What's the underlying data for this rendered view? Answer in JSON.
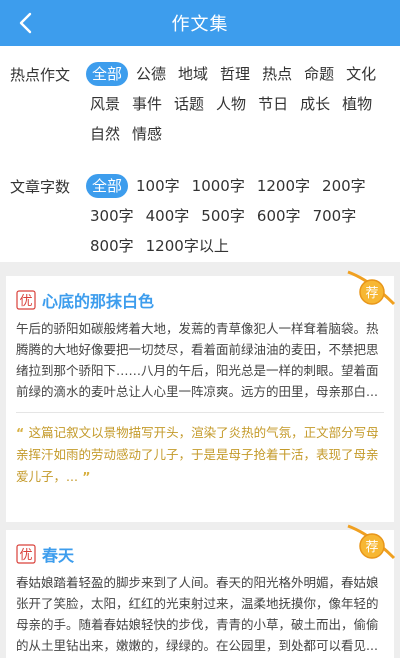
{
  "header": {
    "title": "作文集"
  },
  "filters": {
    "hot": {
      "label": "热点作文",
      "options": [
        "全部",
        "公德",
        "地域",
        "哲理",
        "热点",
        "命题",
        "文化",
        "风景",
        "事件",
        "话题",
        "人物",
        "节日",
        "成长",
        "植物",
        "自然",
        "情感"
      ]
    },
    "words": {
      "label": "文章字数",
      "options": [
        "全部",
        "100字",
        "1000字",
        "1200字",
        "200字",
        "300字",
        "400字",
        "500字",
        "600字",
        "700字",
        "800字",
        "1200字以上"
      ]
    }
  },
  "articles": [
    {
      "badge": "优",
      "title": "心底的那抹白色",
      "rec": "荐",
      "excerpt": "午后的骄阳如碳般烤着大地，发蔫的青草像犯人一样耷着脑袋。热腾腾的大地好像要把一切焚尽，看着面前绿油油的麦田，不禁把思绪拉到那个骄阳下……八月的午后，阳光总是一样的刺眼。望着面前绿的滴水的麦叶总让人心里一阵凉爽。远方的田里，母亲那白...",
      "comment": "这篇记叙文以景物描写开头，渲染了炎热的气氛，正文部分写母亲挥汗如雨的劳动感动了儿子，于是是母子抢着干活，表现了母亲爱儿子，..."
    },
    {
      "badge": "优",
      "title": "春天",
      "rec": "荐",
      "excerpt": "春姑娘踏着轻盈的脚步来到了人间。春天的阳光格外明媚，春姑娘张开了笑脸，太阳，红红的光束射过来，温柔地抚摸你，像年轻的母亲的手。随着春姑娘轻快的步伐，青青的小草，破土而出，偷偷的从土里钻出来，嫩嫩的，绿绿的。在公园里，到处都可以看见..."
    }
  ],
  "colors": {
    "primary": "#3d9ded",
    "badge_red": "#d9403a",
    "rec_orange": "#f0a020"
  }
}
